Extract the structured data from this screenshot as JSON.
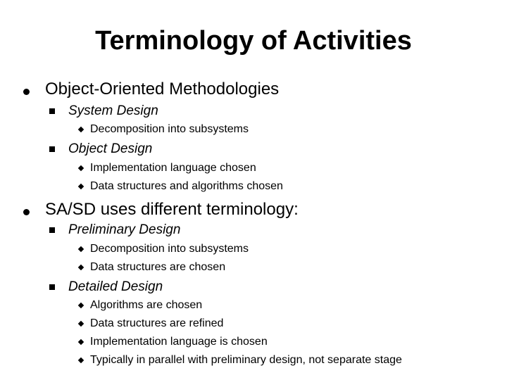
{
  "slide": {
    "title": "Terminology of Activities",
    "sections": [
      {
        "label": "Object-Oriented Methodologies",
        "subsections": [
          {
            "label": "System Design",
            "items": [
              "Decomposition into subsystems"
            ]
          },
          {
            "label": "Object Design",
            "items": [
              "Implementation language chosen",
              "Data structures and algorithms chosen"
            ]
          }
        ]
      },
      {
        "label": "SA/SD uses different terminology:",
        "subsections": [
          {
            "label": "Preliminary Design",
            "items": [
              "Decomposition into subsystems",
              "Data structures are chosen"
            ]
          },
          {
            "label": "Detailed Design",
            "items": [
              "Algorithms are chosen",
              "Data structures are refined",
              "Implementation language is chosen",
              "Typically in parallel with preliminary design, not separate stage"
            ]
          }
        ]
      }
    ]
  }
}
